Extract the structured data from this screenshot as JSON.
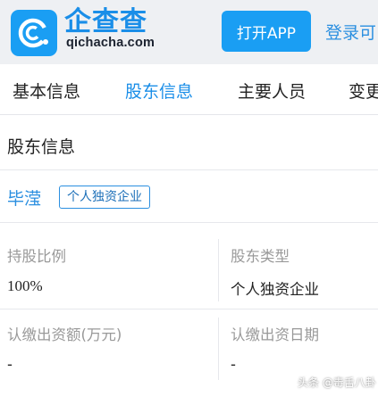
{
  "header": {
    "brand_name": "企查查",
    "brand_url": "qichacha.com",
    "open_app_label": "打开APP",
    "login_label": "登录可",
    "brand_color": "#1a9ef3",
    "logo_icon": "qichacha-logo-icon"
  },
  "tabs": [
    {
      "label": "基本信息",
      "active": false
    },
    {
      "label": "股东信息",
      "active": true
    },
    {
      "label": "主要人员",
      "active": false
    },
    {
      "label": "变更",
      "active": false
    }
  ],
  "section": {
    "title": "股东信息",
    "holder": {
      "name": "毕滢",
      "tag": "个人独资企业"
    },
    "fields": {
      "share_ratio_label": "持股比例",
      "share_ratio_value": "100%",
      "holder_type_label": "股东类型",
      "holder_type_value": "个人独资企业",
      "subscribed_amount_label": "认缴出资额(万元)",
      "subscribed_amount_value": "-",
      "subscribed_date_label": "认缴出资日期",
      "subscribed_date_value": "-"
    }
  },
  "watermark": "头条 @毒舌八卦"
}
